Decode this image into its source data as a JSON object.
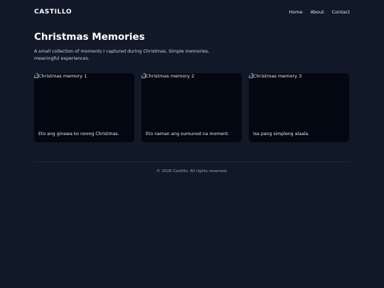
{
  "header": {
    "brand": "CASTILLO",
    "nav": [
      "Home",
      "About",
      "Contact"
    ]
  },
  "hero": {
    "title": "Christmas Memories",
    "subtitle": "A small collection of moments I captured during Christmas. Simple memories, meaningful experiences."
  },
  "cards": [
    {
      "alt": "Christmas memory 1",
      "caption": "Eto ang ginawa ko noong Christmas."
    },
    {
      "alt": "Christmas memory 2",
      "caption": "Eto naman ang sumunod na moment."
    },
    {
      "alt": "Christmas memory 3",
      "caption": "Isa pang simpleng alaala."
    }
  ],
  "footer": {
    "text": "© 2026 Castillo. All rights reserved."
  },
  "colors": {
    "background": "#111827",
    "card": "#030712",
    "divider": "#1f2937"
  }
}
